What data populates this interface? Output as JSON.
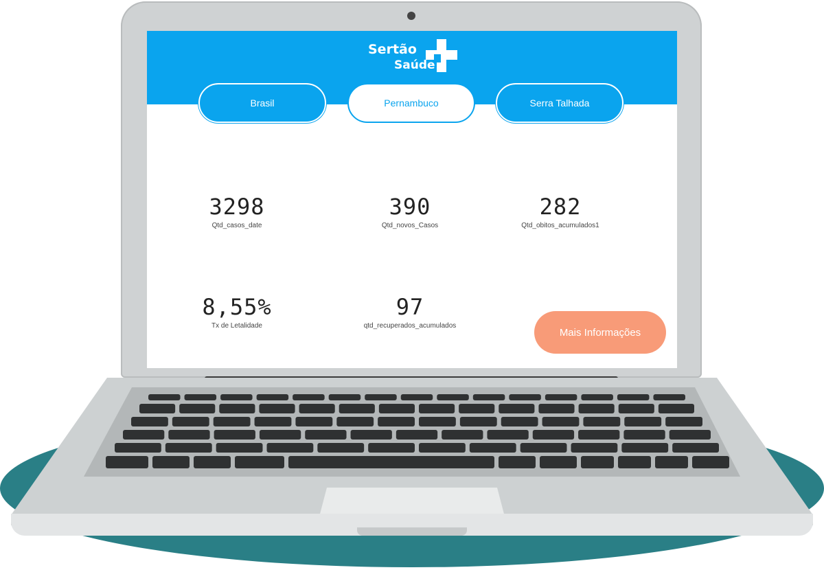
{
  "brand": {
    "line1": "Sertão",
    "line2": "Saúde",
    "logo_icon": "medical-cross-icon"
  },
  "tabs": [
    {
      "label": "Brasil",
      "active": false
    },
    {
      "label": "Pernambuco",
      "active": true
    },
    {
      "label": "Serra Talhada",
      "active": false
    }
  ],
  "kpis": [
    {
      "value": "3298",
      "label": "Qtd_casos_date"
    },
    {
      "value": "390",
      "label": "Qtd_novos_Casos"
    },
    {
      "value": "282",
      "label": "Qtd_obitos_acumulados1"
    },
    {
      "value": "8,55%",
      "label": "Tx de Letalidade"
    },
    {
      "value": "97",
      "label": "qtd_recuperados_acumulados"
    }
  ],
  "more_button": {
    "label": "Mais Informações"
  },
  "colors": {
    "header_blue": "#0aa4ee",
    "button_orange": "#f89b78",
    "backdrop_teal": "#2a7f86"
  }
}
